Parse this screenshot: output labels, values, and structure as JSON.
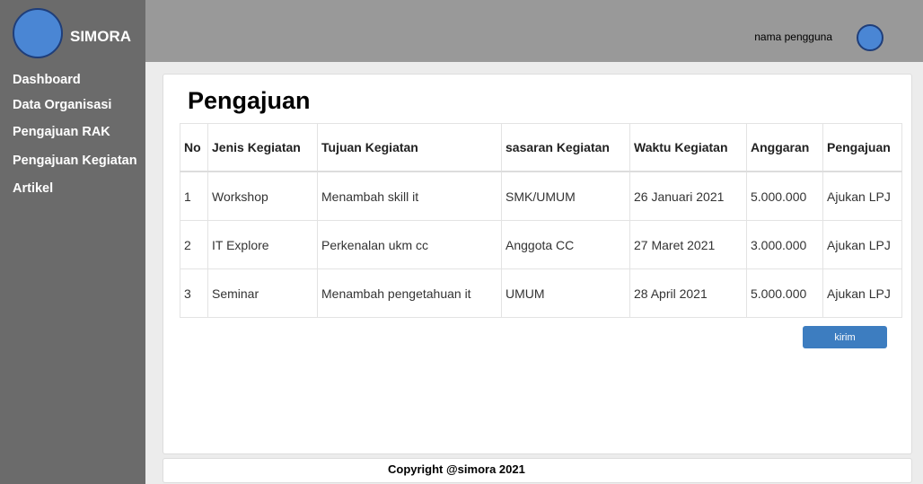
{
  "app": {
    "brand": "SIMORA"
  },
  "sidebar": {
    "items": [
      {
        "label": "Dashboard"
      },
      {
        "label": "Data Organisasi"
      },
      {
        "label": "Pengajuan RAK"
      },
      {
        "label": "Pengajuan Kegiatan"
      },
      {
        "label": "Artikel"
      }
    ]
  },
  "header": {
    "user_name": "nama pengguna"
  },
  "main": {
    "title": "Pengajuan",
    "table": {
      "headers": [
        "No",
        "Jenis Kegiatan",
        "Tujuan Kegiatan",
        "sasaran Kegiatan",
        "Waktu Kegiatan",
        "Anggaran",
        "Pengajuan"
      ],
      "rows": [
        [
          "1",
          "Workshop",
          "Menambah skill it",
          "SMK/UMUM",
          "26 Januari 2021",
          "5.000.000",
          "Ajukan LPJ"
        ],
        [
          "2",
          "IT Explore",
          "Perkenalan ukm cc",
          "Anggota CC",
          "27 Maret 2021",
          "3.000.000",
          "Ajukan LPJ"
        ],
        [
          "3",
          "Seminar",
          "Menambah pengetahuan it",
          "UMUM",
          "28 April 2021",
          "5.000.000",
          "Ajukan LPJ"
        ]
      ]
    },
    "submit_label": "kirim"
  },
  "footer": {
    "copyright": "Copyright @simora 2021"
  },
  "colors": {
    "sidebar": "#6b6b6b",
    "topbar": "#999999",
    "accent": "#3d7dc0",
    "avatar": "#4a86d4"
  }
}
